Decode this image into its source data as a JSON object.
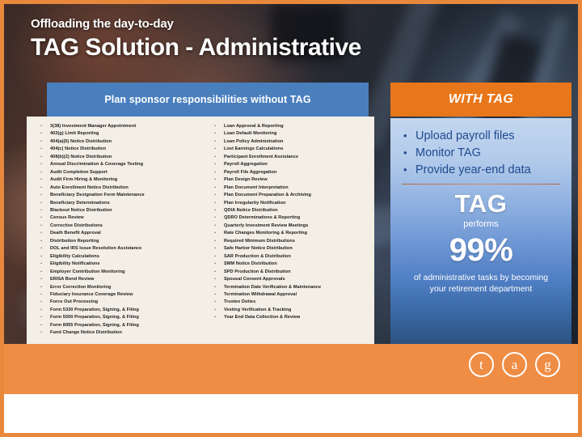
{
  "slide": {
    "eyebrow": "Offloading the day-to-day",
    "title": "TAG Solution - Administrative"
  },
  "colors": {
    "frame_orange": "#e8883c",
    "header_blue": "#4a7fbe",
    "header_orange": "#e8761a",
    "panel_cream": "#f4efe6",
    "footer_orange": "#ef8d45",
    "bullet_blue": "#1f4a8f"
  },
  "without_tag": {
    "header": "Plan sponsor responsibilities without TAG",
    "column1": [
      "3(38) Investment Manager Appointment",
      "402(g) Limit Reporting",
      "404(a)(5) Notice Distribution",
      "404(c) Notice Distribution",
      "408(b)(2) Notice Distribution",
      "Annual Discrimination & Coverage Testing",
      "Audit Completion Support",
      "Audit Firm Hiring & Monitoring",
      "Auto Enrollment Notice Distribution",
      "Beneficiary Designation Form Maintenance",
      "Beneficiary Determinations",
      "Blackout Notice Distribution",
      "Census Review",
      "Corrective Distributions",
      "Death Benefit Approval",
      "Distribution Reporting",
      "DOL and IRS Issue Resolution Assistance",
      "Eligibility Calculations",
      "Eligibility Notifications",
      "Employer Contribution Monitoring",
      "ERISA Bond Review",
      "Error Correction Monitoring",
      "Fiduciary Insurance Coverage Review",
      "Force Out Processing",
      "Form 5330 Preparation, Signing, & Filing",
      "Form 5500 Preparation, Signing, & Filing",
      "Form 8955 Preparation, Signing, & Filing",
      "Fund Change Notice Distribution"
    ],
    "column2": [
      "Loan Approval & Reporting",
      "Loan Default Monitoring",
      "Loan Policy Administration",
      "Lost Earnings Calculations",
      "Participant Enrollment Assistance",
      "Payroll Aggregation",
      "Payroll File Aggregation",
      "Plan Design Review",
      "Plan Document Interpretation",
      "Plan Document Preparation & Archiving",
      "Plan Irregularity Notification",
      "QDIA Notice Distribution",
      "QDRO Determinations & Reporting",
      "Quarterly Investment Review Meetings",
      "Rate Changes Monitoring & Reporting",
      "Required Minimum Distributions",
      "Safe Harbor Notice Distribution",
      "SAR Production & Distribution",
      "SMM Notice Distribution",
      "SPD Production & Distribution",
      "Spousal Consent Approvals",
      "Termination Date Verification & Maintenance",
      "Termination Withdrawal Approval",
      "Trustee Duties",
      "Vesting Verification & Tracking",
      "Year End Data Collection & Review"
    ]
  },
  "with_tag": {
    "header": "WITH TAG",
    "bullets": [
      "Upload payroll files",
      "Monitor TAG",
      "Provide year-end data"
    ],
    "stat": {
      "brand": "TAG",
      "verb": "performs",
      "percent": "99%",
      "caption": "of administrative tasks by becoming your retirement department"
    }
  },
  "logo": {
    "letters": [
      "t",
      "a",
      "g"
    ]
  }
}
